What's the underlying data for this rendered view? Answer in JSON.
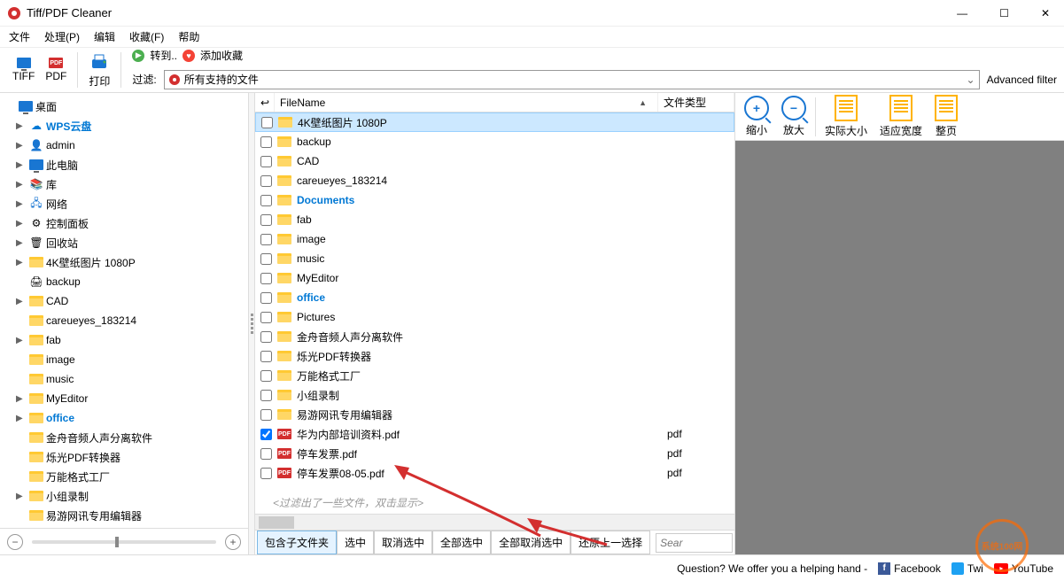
{
  "window": {
    "title": "Tiff/PDF Cleaner"
  },
  "menu": {
    "file": "文件",
    "process": "处理(P)",
    "edit": "编辑",
    "favorites": "收藏(F)",
    "help": "帮助"
  },
  "toolbar": {
    "tiff": "TIFF",
    "pdf": "PDF",
    "print": "打印",
    "filter": "过滤:",
    "convert": "转到..",
    "addfav": "添加收藏",
    "filterSelect": "所有支持的文件",
    "advFilter": "Advanced filter"
  },
  "tree": [
    {
      "exp": "",
      "icon": "monitor",
      "label": "桌面",
      "color": "#000",
      "indent": 0
    },
    {
      "exp": "▶",
      "icon": "cloud",
      "label": "WPS云盘",
      "color": "#0078D4",
      "bold": true,
      "indent": 1
    },
    {
      "exp": "▶",
      "icon": "user",
      "label": "admin",
      "color": "#000",
      "indent": 1
    },
    {
      "exp": "▶",
      "icon": "monitor",
      "label": "此电脑",
      "color": "#000",
      "indent": 1
    },
    {
      "exp": "▶",
      "icon": "lib",
      "label": "库",
      "color": "#000",
      "indent": 1
    },
    {
      "exp": "▶",
      "icon": "net",
      "label": "网络",
      "color": "#000",
      "indent": 1
    },
    {
      "exp": "▶",
      "icon": "panel",
      "label": "控制面板",
      "color": "#000",
      "indent": 1
    },
    {
      "exp": "▶",
      "icon": "bin",
      "label": "回收站",
      "color": "#000",
      "indent": 1
    },
    {
      "exp": "▶",
      "icon": "folder",
      "label": "4K壁纸图片 1080P",
      "color": "#000",
      "indent": 1
    },
    {
      "exp": "",
      "icon": "printer",
      "label": "backup",
      "color": "#000",
      "indent": 1
    },
    {
      "exp": "▶",
      "icon": "folder",
      "label": "CAD",
      "color": "#000",
      "indent": 1
    },
    {
      "exp": "",
      "icon": "folder",
      "label": "careueyes_183214",
      "color": "#000",
      "indent": 1
    },
    {
      "exp": "▶",
      "icon": "folder",
      "label": "fab",
      "color": "#000",
      "indent": 1
    },
    {
      "exp": "",
      "icon": "folder",
      "label": "image",
      "color": "#000",
      "indent": 1
    },
    {
      "exp": "",
      "icon": "folder",
      "label": "music",
      "color": "#000",
      "indent": 1
    },
    {
      "exp": "▶",
      "icon": "folder",
      "label": "MyEditor",
      "color": "#000",
      "indent": 1
    },
    {
      "exp": "▶",
      "icon": "folder",
      "label": "office",
      "color": "#0078D4",
      "bold": true,
      "indent": 1
    },
    {
      "exp": "",
      "icon": "folder",
      "label": "金舟音频人声分离软件",
      "color": "#000",
      "indent": 1
    },
    {
      "exp": "",
      "icon": "folder",
      "label": "烁光PDF转换器",
      "color": "#000",
      "indent": 1
    },
    {
      "exp": "",
      "icon": "folder",
      "label": "万能格式工厂",
      "color": "#000",
      "indent": 1
    },
    {
      "exp": "▶",
      "icon": "folder",
      "label": "小组录制",
      "color": "#000",
      "indent": 1
    },
    {
      "exp": "",
      "icon": "folder",
      "label": "易游网讯专用编辑器",
      "color": "#000",
      "indent": 1
    }
  ],
  "listHeader": {
    "check": "",
    "name": "FileName",
    "type": "文件类型"
  },
  "files": [
    {
      "checked": false,
      "icon": "folder",
      "name": "4K壁纸图片 1080P",
      "type": "",
      "selected": true
    },
    {
      "checked": false,
      "icon": "folder",
      "name": "backup",
      "type": ""
    },
    {
      "checked": false,
      "icon": "folder",
      "name": "CAD",
      "type": ""
    },
    {
      "checked": false,
      "icon": "folder",
      "name": "careueyes_183214",
      "type": ""
    },
    {
      "checked": false,
      "icon": "folder",
      "name": "Documents",
      "type": "",
      "bold": true,
      "color": "#0078D4"
    },
    {
      "checked": false,
      "icon": "folder",
      "name": "fab",
      "type": ""
    },
    {
      "checked": false,
      "icon": "folder",
      "name": "image",
      "type": ""
    },
    {
      "checked": false,
      "icon": "folder",
      "name": "music",
      "type": ""
    },
    {
      "checked": false,
      "icon": "folder",
      "name": "MyEditor",
      "type": ""
    },
    {
      "checked": false,
      "icon": "folder",
      "name": "office",
      "type": "",
      "bold": true,
      "color": "#0078D4"
    },
    {
      "checked": false,
      "icon": "folder",
      "name": "Pictures",
      "type": ""
    },
    {
      "checked": false,
      "icon": "folder",
      "name": "金舟音频人声分离软件",
      "type": ""
    },
    {
      "checked": false,
      "icon": "folder",
      "name": "烁光PDF转换器",
      "type": ""
    },
    {
      "checked": false,
      "icon": "folder",
      "name": "万能格式工厂",
      "type": ""
    },
    {
      "checked": false,
      "icon": "folder",
      "name": "小组录制",
      "type": ""
    },
    {
      "checked": false,
      "icon": "folder",
      "name": "易游网讯专用编辑器",
      "type": ""
    },
    {
      "checked": true,
      "icon": "pdf",
      "name": "华为内部培训资料.pdf",
      "type": "pdf"
    },
    {
      "checked": false,
      "icon": "pdf",
      "name": "停车发票.pdf",
      "type": "pdf"
    },
    {
      "checked": false,
      "icon": "pdf",
      "name": "停车发票08-05.pdf",
      "type": "pdf"
    }
  ],
  "filterMsg": "<过滤出了一些文件，双击显示>",
  "listFooter": {
    "includeSub": "包含子文件夹",
    "check": "选中",
    "uncheck": "取消选中",
    "checkAll": "全部选中",
    "uncheckAll": "全部取消选中",
    "undo": "还原上一选择",
    "search": "Sear"
  },
  "preview": {
    "zoomOut": "缩小",
    "zoomIn": "放大",
    "actual": "实际大小",
    "fitWidth": "适应宽度",
    "wholePage": "整页"
  },
  "status": {
    "question": "Question? We offer you a helping hand -",
    "fb": "Facebook",
    "tw": "Twi",
    "yt": "YouTube"
  },
  "watermark": "系统100网"
}
